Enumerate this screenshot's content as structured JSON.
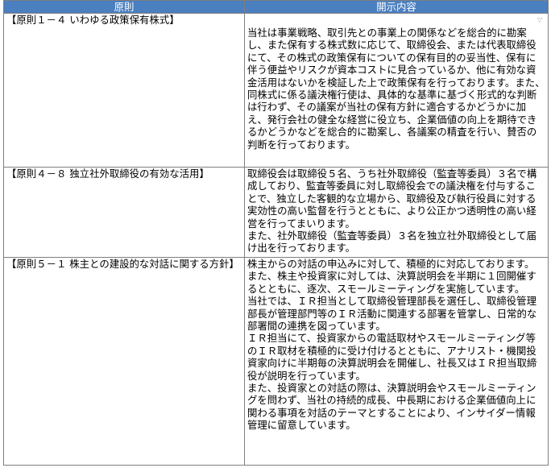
{
  "table": {
    "headers": [
      "原則",
      "開示内容"
    ],
    "rows": [
      {
        "principle": "【原則１－４ いわゆる政策保有株式】",
        "paragraphs": [
          "当社は事業戦略、取引先との事業上の関係などを総合的に勘案し、また保有する株式数に応じて、取締役会、または代表取締役にて、その株式の政策保有についての保有目的の妥当性、保有に伴う便益やリスクが資本コストに見合っているか、他に有効な資金活用はないかを検証した上で政策保有を行っております。また、同株式に係る議決権行使は、具体的な基準に基づく形式的な判断は行わず、その議案が当社の保有方針に適合するかどうかに加え、発行会社の健全な経営に役立ち、企業価値の向上を期待できるかどうかなどを総合的に勘案し、各議案の精査を行い、賛否の判断を行っております。"
        ]
      },
      {
        "principle": "【原則４－８ 独立社外取締役の有効な活用】",
        "paragraphs": [
          "取締役会は取締役５名、うち社外取締役（監査等委員）３名で構成しており、監査等委員に対し取締役会での議決権を付与することで、独立した客観的な立場から、取締役及び執行役員に対する実効性の高い監督を行うとともに、より公正かつ透明性の高い経営を行ってまいります。",
          "また、社外取締役（監査等委員）３名を独立社外取締役として届け出を行っております。"
        ]
      },
      {
        "principle": "【原則５－１ 株主との建設的な対話に関する方針】",
        "paragraphs": [
          "株主からの対話の申込みに対して、積極的に対応しております。",
          "また、株主や投資家に対しては、決算説明会を半期に１回開催するとともに、逐次、スモールミーティングを実施しています。",
          "当社では、ＩＲ担当として取締役管理部長を選任し、取締役管理部長が管理部門等のＩＲ活動に関連する部署を管掌し、日常的な部署間の連携を図っています。",
          "ＩＲ担当にて、投資家からの電話取材やスモールミーティング等のＩＲ取材を積極的に受け付けるとともに、アナリスト・機関投資家向けに半期毎の決算説明会を開催し、社長又はＩＲ担当取締役が説明を行っています。",
          "また、投資家との対話の際は、決算説明会やスモールミーティングを問わず、当社の持続的成長、中長期における企業価値向上に関わる事項を対話のテーマとすることにより、インサイダー情報管理に留意しています。"
        ]
      }
    ]
  }
}
